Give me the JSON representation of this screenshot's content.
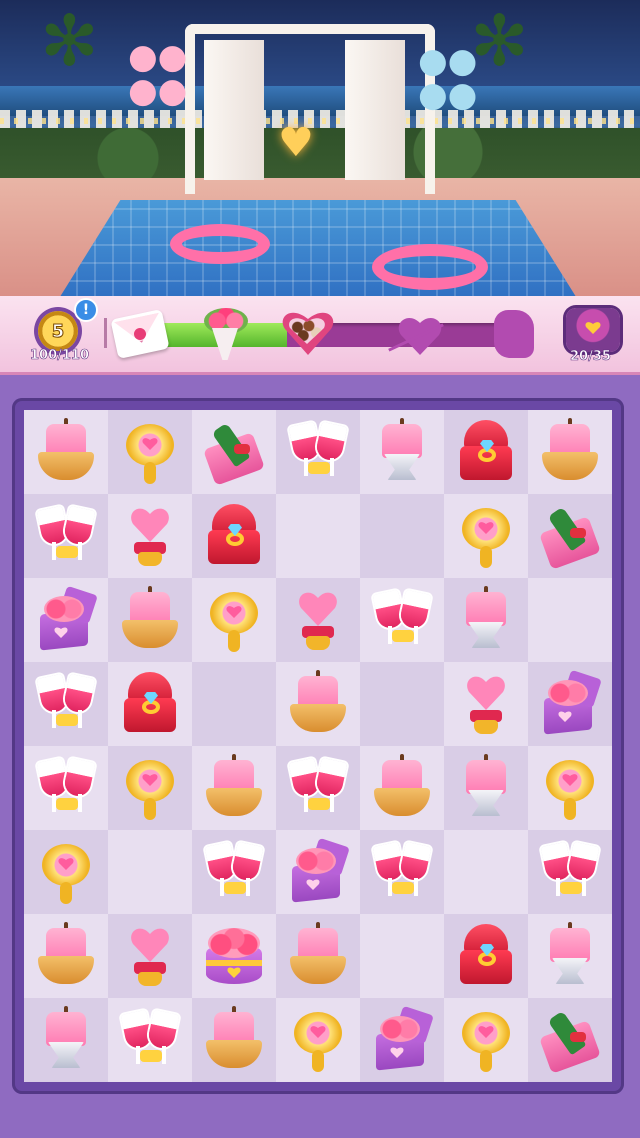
{
  "header": {
    "level": "5",
    "alert_badge": "!",
    "level_progress": "100/110",
    "progress_fraction": 0.36,
    "orders": "20/35"
  },
  "board": {
    "rows": [
      [
        "cake",
        "mirror",
        "wine-box",
        "glasses",
        "cake-cup",
        "ring-box",
        "cake"
      ],
      [
        "glasses",
        "heart-stand",
        "ring-box",
        "",
        "",
        "mirror",
        "wine-box"
      ],
      [
        "rose-box",
        "cake",
        "mirror",
        "heart-stand",
        "glasses",
        "cake-cup",
        ""
      ],
      [
        "glasses",
        "ring-box",
        "",
        "cake",
        "",
        "heart-stand",
        "rose-box"
      ],
      [
        "glasses",
        "mirror",
        "cake",
        "glasses",
        "cake",
        "cake-cup",
        "mirror"
      ],
      [
        "mirror",
        "",
        "glasses",
        "rose-box",
        "glasses",
        "",
        "glasses"
      ],
      [
        "cake",
        "heart-stand",
        "flower-hatbox",
        "cake",
        "",
        "ring-box",
        "cake-cup"
      ],
      [
        "cake-cup",
        "glasses",
        "cake",
        "mirror",
        "rose-box",
        "mirror",
        "wine-box"
      ]
    ]
  }
}
